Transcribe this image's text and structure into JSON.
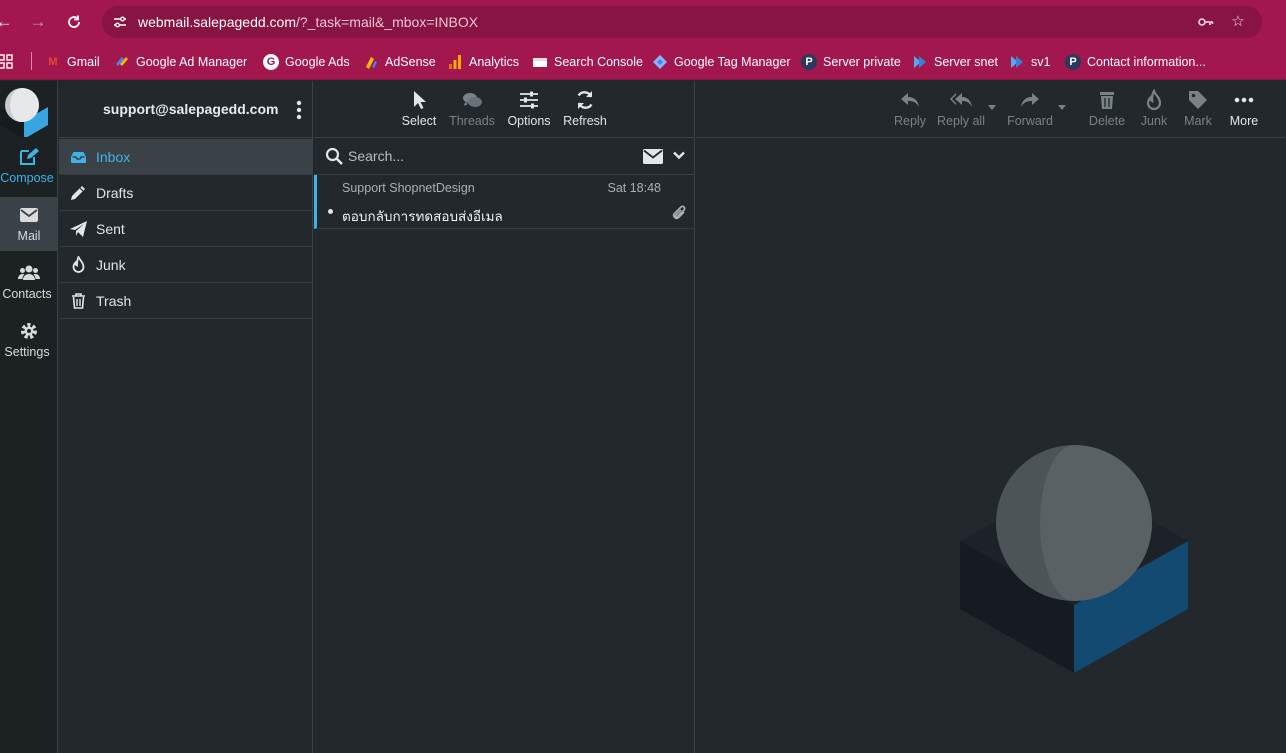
{
  "browser": {
    "url_host": "webmail.salepagedd.com",
    "url_path": "/?_task=mail&_mbox=INBOX",
    "bookmarks": [
      {
        "label": "Gmail"
      },
      {
        "label": "Google Ad Manager"
      },
      {
        "label": "Google Ads"
      },
      {
        "label": "AdSense"
      },
      {
        "label": "Analytics"
      },
      {
        "label": "Search Console"
      },
      {
        "label": "Google Tag Manager"
      },
      {
        "label": "Server private"
      },
      {
        "label": "Server snet"
      },
      {
        "label": "sv1"
      },
      {
        "label": "Contact information..."
      }
    ]
  },
  "rail": {
    "items": [
      {
        "label": "Compose",
        "icon": "compose-icon"
      },
      {
        "label": "Mail",
        "icon": "mail-icon"
      },
      {
        "label": "Contacts",
        "icon": "contacts-icon"
      },
      {
        "label": "Settings",
        "icon": "gear-icon"
      }
    ]
  },
  "account": {
    "name": "support@salepagedd.com"
  },
  "folders": [
    {
      "label": "Inbox",
      "icon": "inbox-icon"
    },
    {
      "label": "Drafts",
      "icon": "pencil-icon"
    },
    {
      "label": "Sent",
      "icon": "paper-plane-icon"
    },
    {
      "label": "Junk",
      "icon": "fire-icon"
    },
    {
      "label": "Trash",
      "icon": "trash-icon"
    }
  ],
  "list_toolbar": {
    "select": "Select",
    "threads": "Threads",
    "options": "Options",
    "refresh": "Refresh"
  },
  "search": {
    "placeholder": "Search..."
  },
  "messages": [
    {
      "from": "Support ShopnetDesign",
      "date": "Sat 18:48",
      "subject": "ตอบกลับการทดสอบส่งอีเมล",
      "has_attachment": true,
      "unread": true
    }
  ],
  "preview_toolbar": {
    "reply": "Reply",
    "reply_all": "Reply all",
    "forward": "Forward",
    "delete": "Delete",
    "junk": "Junk",
    "mark": "Mark",
    "more": "More"
  },
  "colors": {
    "browser_bar": "#a3174f",
    "accent": "#3fb2e8",
    "background": "#22282b"
  }
}
